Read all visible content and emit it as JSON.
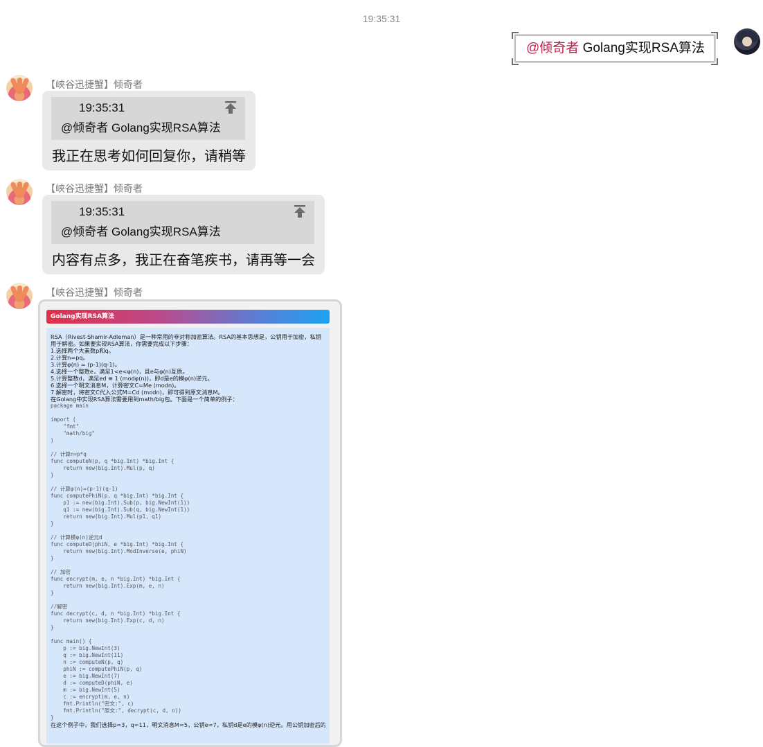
{
  "timestamp": "19:35:31",
  "self_message": {
    "mention": "@倾奇者",
    "text": " Golang实现RSA算法"
  },
  "bot_name": "【峡谷迅捷蟹】倾奇者",
  "messages": [
    {
      "quote_time": "19:35:31",
      "quote_text": "@倾奇者 Golang实现RSA算法",
      "reply": "我正在思考如何回复你，请稍等"
    },
    {
      "quote_time": "19:35:31",
      "quote_text": "@倾奇者 Golang实现RSA算法",
      "reply": "内容有点多，我正在奋笔疾书，请再等一会"
    }
  ],
  "card": {
    "title": "Golang实现RSA算法",
    "intro": [
      "RSA（Rivest-Shamir-Adleman）是一种常用的非对称加密算法。RSA的基本思想是，公钥用于加密，私钥",
      "用于解密。如果要实现RSA算法，你需要完成以下步骤：",
      "1.选择两个大素数p和q。",
      "2.计算n=pq。",
      "3.计算φ(n) = (p-1)(q-1)。",
      "4.选择一个整数e，满足1<e<φ(n)，且e与φ(n)互质。",
      "5.计算整数d，满足ed ≡ 1 (modφ(n))，即d是e的模φ(n)逆元。",
      "6.选择一个明文消息M，计算密文C=Me (modn)。",
      "7.解密时，将密文C代入公式M=Cd (modn)，即可得到原文消息M。",
      "在Golang中实现RSA算法需要用到math/big包。下面是一个简单的例子："
    ],
    "code": [
      "package main",
      "",
      "import (",
      "    \"fmt\"",
      "    \"math/big\"",
      ")",
      "",
      "// 计算n=p*q",
      "func computeN(p, q *big.Int) *big.Int {",
      "    return new(big.Int).Mul(p, q)",
      "}",
      "",
      "// 计算φ(n)=(p-1)(q-1)",
      "func computePhiN(p, q *big.Int) *big.Int {",
      "    p1 := new(big.Int).Sub(p, big.NewInt(1))",
      "    q1 := new(big.Int).Sub(q, big.NewInt(1))",
      "    return new(big.Int).Mul(p1, q1)",
      "}",
      "",
      "// 计算模φ(n)逆元d",
      "func computeD(phiN, e *big.Int) *big.Int {",
      "    return new(big.Int).ModInverse(e, phiN)",
      "}",
      "",
      "// 加密",
      "func encrypt(m, e, n *big.Int) *big.Int {",
      "    return new(big.Int).Exp(m, e, n)",
      "}",
      "",
      "//解密",
      "func decrypt(c, d, n *big.Int) *big.Int {",
      "    return new(big.Int).Exp(c, d, n)",
      "}",
      "",
      "func main() {",
      "    p := big.NewInt(3)",
      "    q := big.NewInt(11)",
      "    n := computeN(p, q)",
      "    phiN := computePhiN(p, q)",
      "    e := big.NewInt(7)",
      "    d := computeD(phiN, e)",
      "    m := big.NewInt(5)",
      "    c := encrypt(m, e, n)",
      "    fmt.Println(\"密文:\", c)",
      "    fmt.Println(\"原文:\", decrypt(c, d, n))",
      "}"
    ],
    "footer_partial": "在这个例子中，我们选择p=3，q=11，明文消息M=5，公钥e=7，私钥d是e的模φ(n)逆元。用公钥加密后的"
  }
}
